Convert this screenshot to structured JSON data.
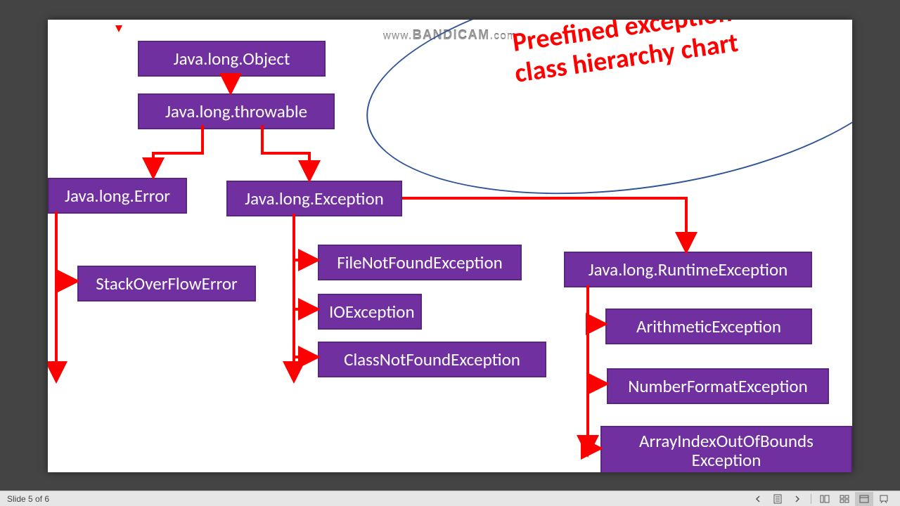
{
  "watermark": {
    "prefix": "www.",
    "brand": "BANDICAM",
    "suffix": ".com"
  },
  "title": {
    "line1": "Preefined exception",
    "line2": "class hierarchy chart"
  },
  "nodes": {
    "object": "Java.long.Object",
    "throwable": "Java.long.throwable",
    "error": "Java.long.Error",
    "exception": "Java.long.Exception",
    "stackoverflow": "StackOverFlowError",
    "fnf": "FileNotFoundException",
    "io": "IOException",
    "cnf": "ClassNotFoundException",
    "runtime": "Java.long.RuntimeException",
    "arithmetic": "ArithmeticException",
    "numberformat": "NumberFormatException",
    "aioob": "ArrayIndexOutOfBounds\nException"
  },
  "status": {
    "slide_label": "Slide 5 of 6"
  },
  "colors": {
    "box_bg": "#7030a0",
    "arrow": "#ff0000",
    "title": "#ff0000"
  },
  "chart_data": {
    "type": "tree",
    "title": "Preefined exception class hierarchy chart",
    "root": "Java.long.Object",
    "edges": [
      [
        "Java.long.Object",
        "Java.long.throwable"
      ],
      [
        "Java.long.throwable",
        "Java.long.Error"
      ],
      [
        "Java.long.throwable",
        "Java.long.Exception"
      ],
      [
        "Java.long.Error",
        "StackOverFlowError"
      ],
      [
        "Java.long.Exception",
        "FileNotFoundException"
      ],
      [
        "Java.long.Exception",
        "IOException"
      ],
      [
        "Java.long.Exception",
        "ClassNotFoundException"
      ],
      [
        "Java.long.Exception",
        "Java.long.RuntimeException"
      ],
      [
        "Java.long.RuntimeException",
        "ArithmeticException"
      ],
      [
        "Java.long.RuntimeException",
        "NumberFormatException"
      ],
      [
        "Java.long.RuntimeException",
        "ArrayIndexOutOfBoundsException"
      ]
    ]
  }
}
